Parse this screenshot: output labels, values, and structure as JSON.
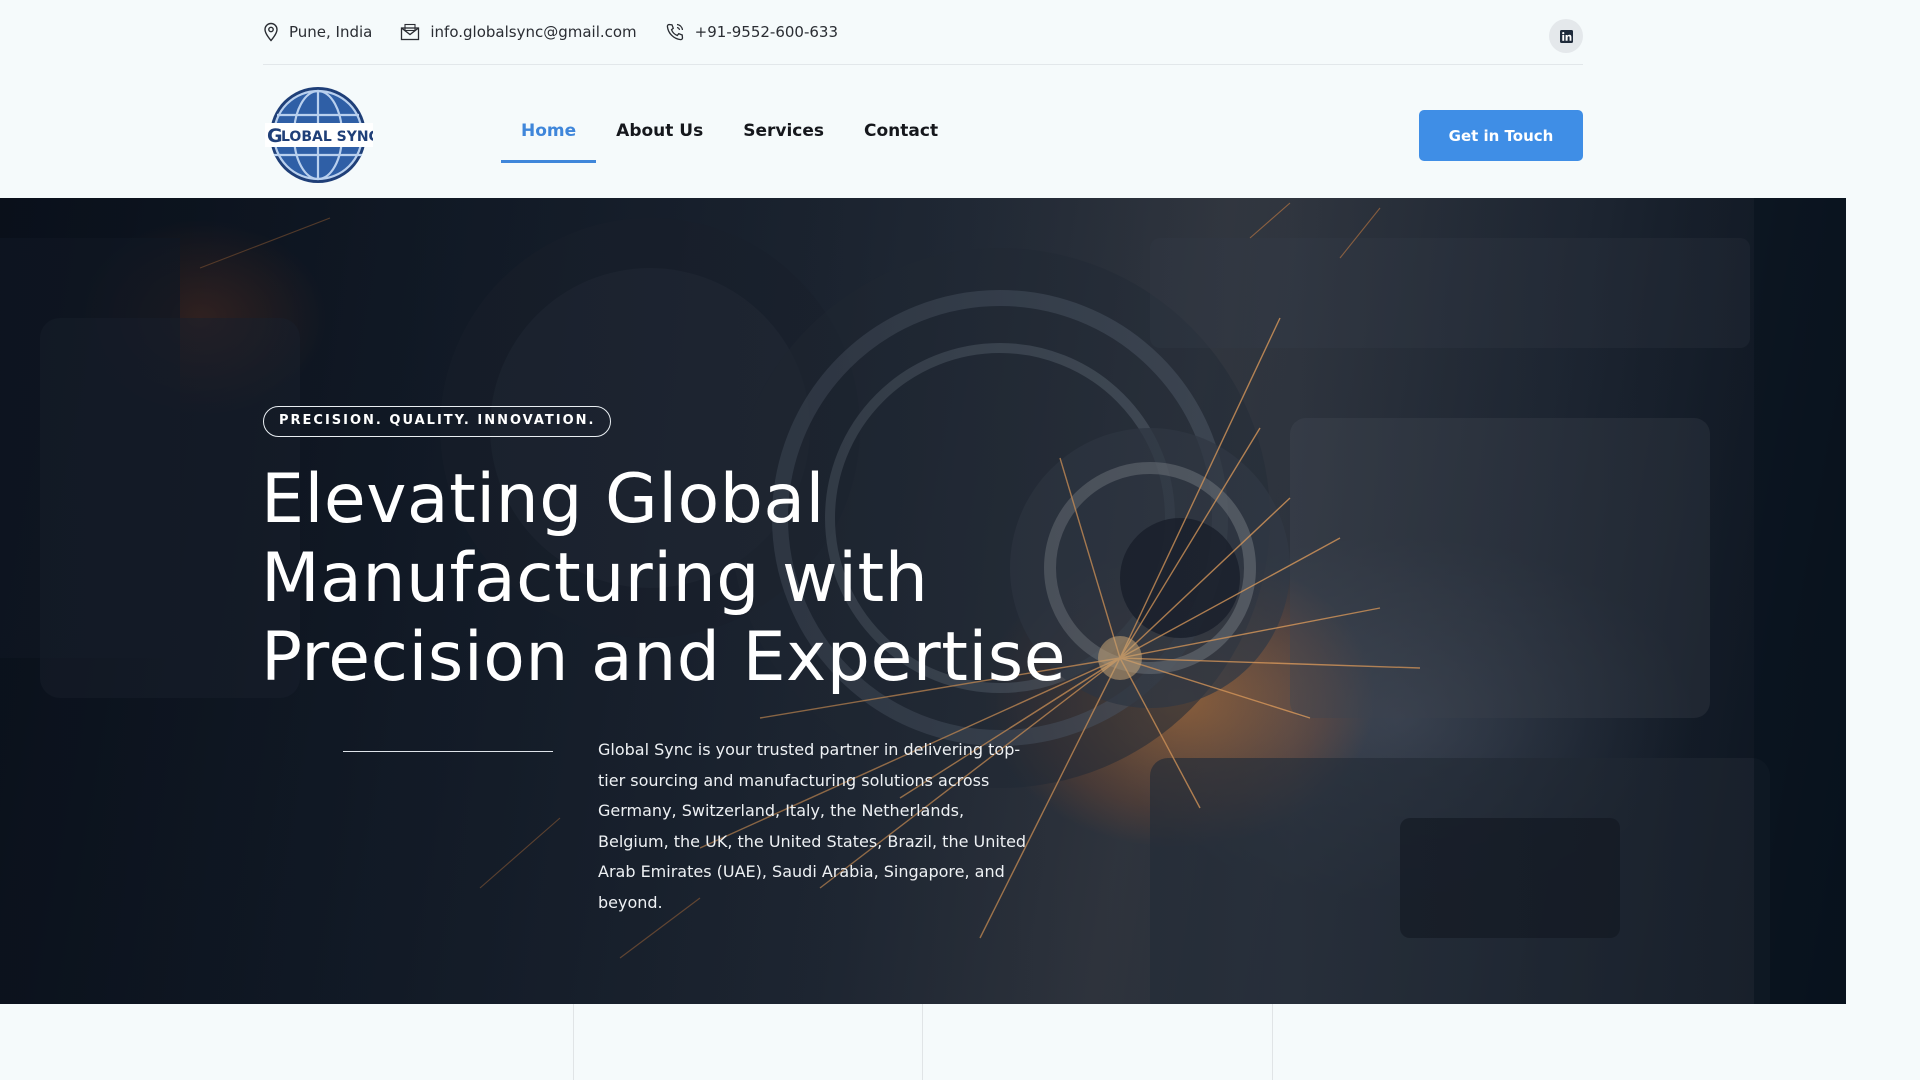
{
  "topbar": {
    "location": "Pune, India",
    "email": "info.globalsync@gmail.com",
    "phone": "+91-9552-600-633"
  },
  "logo": {
    "text": "GLOBAL SYNC"
  },
  "nav": {
    "items": [
      {
        "label": "Home",
        "active": true
      },
      {
        "label": "About Us"
      },
      {
        "label": "Services"
      },
      {
        "label": "Contact"
      }
    ]
  },
  "header": {
    "cta_label": "Get in Touch"
  },
  "hero": {
    "badge": "PRECISION. QUALITY. INNOVATION.",
    "headline_line1": "Elevating Global",
    "headline_line2": "Manufacturing with",
    "headline_line3": "Precision and Expertise",
    "description": "Global Sync is your trusted partner in delivering top-tier sourcing and manufacturing solutions across Germany, Switzerland, Italy, the Netherlands, Belgium, the UK, the United States, Brazil, the United Arab Emirates (UAE), Saudi Arabia, Singapore, and beyond."
  },
  "colors": {
    "accent": "#3f86da",
    "button": "#3f8ee6",
    "page_bg": "#f5fafb"
  },
  "icons": [
    "location-pin-icon",
    "envelope-icon",
    "phone-icon",
    "linkedin-icon"
  ]
}
